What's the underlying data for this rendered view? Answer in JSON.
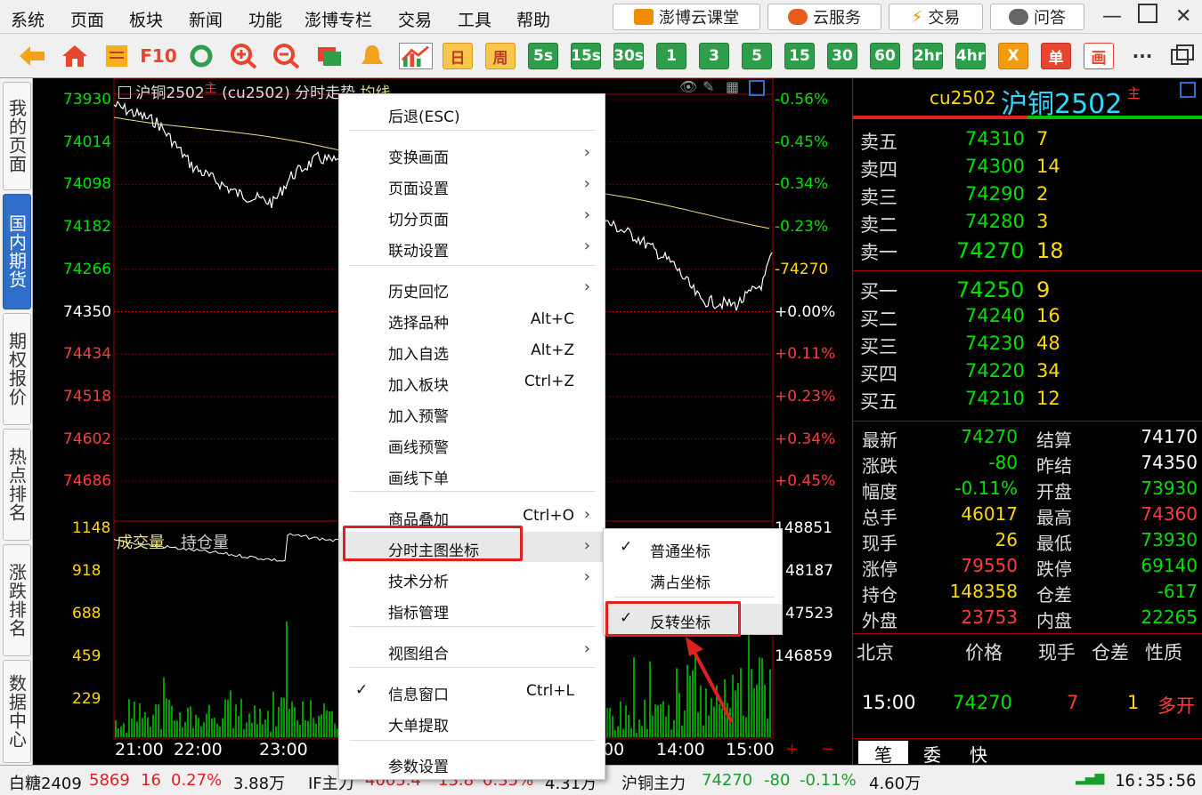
{
  "menubar": {
    "items": [
      "系统",
      "页面",
      "板块",
      "新闻",
      "功能",
      "澎博专栏",
      "交易",
      "工具",
      "帮助"
    ],
    "buttons": {
      "course": "澎博云课堂",
      "cloud": "云服务",
      "trade": "交易",
      "qa": "问答"
    }
  },
  "toolbar": {
    "periods": [
      "日",
      "周",
      "5s",
      "15s",
      "30s",
      "1",
      "3",
      "5",
      "15",
      "30",
      "60",
      "2hr",
      "4hr"
    ],
    "x_label": "X",
    "single_label": "单",
    "draw_label": "画",
    "more": "···"
  },
  "sidebar": {
    "tabs": [
      "我的页面",
      "国内期货",
      "期权报价",
      "热点排名",
      "涨跌排名",
      "数据中心"
    ],
    "active": "国内期货"
  },
  "chart": {
    "title_name": "沪铜2502",
    "title_main": "主",
    "title_code": "(cu2502) 分时走势",
    "title_avg": "均线",
    "price_labels": [
      "73930",
      "74014",
      "74098",
      "74182",
      "74266",
      "74350",
      "74434",
      "74518",
      "74602",
      "74686"
    ],
    "pct_labels": [
      "-0.56%",
      "-0.45%",
      "-0.34%",
      "-0.23%",
      "-74270",
      "+0.00%",
      "+0.11%",
      "+0.23%",
      "+0.34%",
      "+0.45%"
    ],
    "vol_labels": [
      "1148",
      "918",
      "688",
      "459",
      "229"
    ],
    "oi_labels": [
      "148851",
      "48187",
      "47523",
      "146859"
    ],
    "vol_title": "成交量",
    "oi_title": "持仓量",
    "time_labels": [
      "21:00",
      "22:00",
      "23:00",
      "00",
      "14:00",
      "15:00"
    ]
  },
  "context_menu": {
    "items": [
      {
        "label": "后退(ESC)",
        "shortcut": "",
        "arrow": false,
        "check": false
      },
      {
        "label": "变换画面",
        "shortcut": "",
        "arrow": true,
        "check": false
      },
      {
        "label": "页面设置",
        "shortcut": "",
        "arrow": true,
        "check": false
      },
      {
        "label": "切分页面",
        "shortcut": "",
        "arrow": true,
        "check": false
      },
      {
        "label": "联动设置",
        "shortcut": "",
        "arrow": true,
        "check": false
      },
      {
        "label": "历史回忆",
        "shortcut": "",
        "arrow": true,
        "check": false
      },
      {
        "label": "选择品种",
        "shortcut": "Alt+C",
        "arrow": false,
        "check": false
      },
      {
        "label": "加入自选",
        "shortcut": "Alt+Z",
        "arrow": false,
        "check": false
      },
      {
        "label": "加入板块",
        "shortcut": "Ctrl+Z",
        "arrow": false,
        "check": false
      },
      {
        "label": "加入预警",
        "shortcut": "",
        "arrow": false,
        "check": false
      },
      {
        "label": "画线预警",
        "shortcut": "",
        "arrow": false,
        "check": false
      },
      {
        "label": "画线下单",
        "shortcut": "",
        "arrow": false,
        "check": false
      },
      {
        "label": "商品叠加",
        "shortcut": "Ctrl+O",
        "arrow": true,
        "check": false
      },
      {
        "label": "分时主图坐标",
        "shortcut": "",
        "arrow": true,
        "check": false
      },
      {
        "label": "技术分析",
        "shortcut": "",
        "arrow": true,
        "check": false
      },
      {
        "label": "指标管理",
        "shortcut": "",
        "arrow": false,
        "check": false
      },
      {
        "label": "视图组合",
        "shortcut": "",
        "arrow": true,
        "check": false
      },
      {
        "label": "信息窗口",
        "shortcut": "Ctrl+L",
        "arrow": false,
        "check": true
      },
      {
        "label": "大单提取",
        "shortcut": "",
        "arrow": false,
        "check": false
      },
      {
        "label": "参数设置",
        "shortcut": "",
        "arrow": false,
        "check": false
      }
    ]
  },
  "submenu": {
    "items": [
      {
        "label": "普通坐标",
        "check": true
      },
      {
        "label": "满占坐标",
        "check": false
      },
      {
        "label": "反转坐标",
        "check": true
      }
    ]
  },
  "quote": {
    "code": "cu2502",
    "name": "沪铜2502",
    "main": "主",
    "asks": [
      [
        "卖五",
        "74310",
        "7"
      ],
      [
        "卖四",
        "74300",
        "14"
      ],
      [
        "卖三",
        "74290",
        "2"
      ],
      [
        "卖二",
        "74280",
        "3"
      ],
      [
        "卖一",
        "74270",
        "18"
      ]
    ],
    "bids": [
      [
        "买一",
        "74250",
        "9"
      ],
      [
        "买二",
        "74240",
        "16"
      ],
      [
        "买三",
        "74230",
        "48"
      ],
      [
        "买四",
        "74220",
        "34"
      ],
      [
        "买五",
        "74210",
        "12"
      ]
    ],
    "stats": [
      [
        "最新",
        "74270",
        "结算",
        "74170"
      ],
      [
        "涨跌",
        "-80",
        "昨结",
        "74350"
      ],
      [
        "幅度",
        "-0.11%",
        "开盘",
        "73930"
      ],
      [
        "总手",
        "46017",
        "最高",
        "74360"
      ],
      [
        "现手",
        "26",
        "最低",
        "73930"
      ],
      [
        "涨停",
        "79550",
        "跌停",
        "69140"
      ],
      [
        "持仓",
        "148358",
        "仓差",
        "-617"
      ],
      [
        "外盘",
        "23753",
        "内盘",
        "22265"
      ]
    ],
    "tick_header": [
      "北京",
      "价格",
      "现手",
      "仓差",
      "性质"
    ],
    "tick": [
      "15:00",
      "74270",
      "7",
      "1",
      "多开"
    ],
    "tabs": [
      "笔",
      "委",
      "快"
    ]
  },
  "statusbar": {
    "s1_name": "白糖2409",
    "s1_price": "5869",
    "s1_chg": "16",
    "s1_pct": "0.27%",
    "s1_vol": "3.88万",
    "s2_name": "IF主力",
    "s2_price": "4005.4",
    "s2_chg": "13.8",
    "s2_pct": "0.35%",
    "s2_vol": "4.31万",
    "s3_name": "沪铜主力",
    "s3_price": "74270",
    "s3_chg": "-80",
    "s3_pct": "-0.11%",
    "s3_vol": "4.60万",
    "time": "16:35:56"
  }
}
